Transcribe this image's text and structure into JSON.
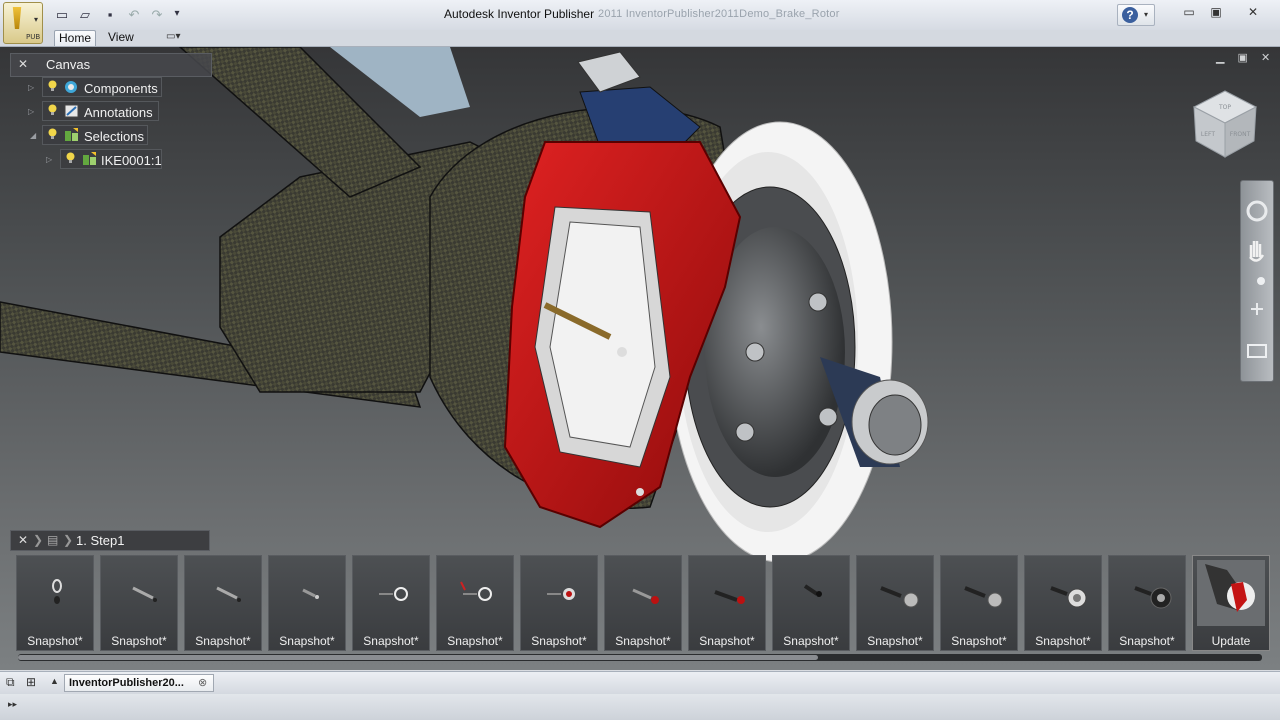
{
  "app": {
    "title": "Autodesk Inventor Publisher",
    "title_detail": "2011   InventorPublisher2011Demo_Brake_Rotor",
    "app_button_badge": "PUB"
  },
  "quick_access": [
    {
      "name": "new-icon",
      "glyph": "▭"
    },
    {
      "name": "open-icon",
      "glyph": "▱"
    },
    {
      "name": "save-icon",
      "glyph": "▪"
    },
    {
      "name": "undo-icon",
      "glyph": "↶"
    },
    {
      "name": "redo-icon",
      "glyph": "↷"
    },
    {
      "name": "qat-dropdown-icon",
      "glyph": "▾"
    }
  ],
  "ribbon": {
    "tabs": [
      {
        "label": "Home",
        "active": true
      },
      {
        "label": "View",
        "active": false
      }
    ]
  },
  "window_controls": {
    "minimize": "▭",
    "restore": "▣",
    "close": "✕"
  },
  "canvas_browser": {
    "title": "Canvas",
    "items": [
      {
        "label": "Components",
        "icon": "components-icon"
      },
      {
        "label": "Annotations",
        "icon": "annotations-icon"
      },
      {
        "label": "Selections",
        "icon": "selections-icon"
      },
      {
        "label": "IKE0001:1",
        "icon": "part-icon"
      }
    ]
  },
  "viewcube": {
    "faces": [
      "TOP",
      "LEFT",
      "FRONT"
    ]
  },
  "storyboard": {
    "step_label": "1. Step1",
    "snapshots": [
      {
        "caption": "Snapshot*"
      },
      {
        "caption": "Snapshot*"
      },
      {
        "caption": "Snapshot*"
      },
      {
        "caption": "Snapshot*"
      },
      {
        "caption": "Snapshot*"
      },
      {
        "caption": "Snapshot*"
      },
      {
        "caption": "Snapshot*"
      },
      {
        "caption": "Snapshot*"
      },
      {
        "caption": "Snapshot*"
      },
      {
        "caption": "Snapshot*"
      },
      {
        "caption": "Snapshot*"
      },
      {
        "caption": "Snapshot*"
      },
      {
        "caption": "Snapshot*"
      },
      {
        "caption": "Snapshot*"
      },
      {
        "caption": "Update"
      }
    ]
  },
  "document_tabs": [
    {
      "label": "InventorPublisher20...",
      "close_glyph": "⊗"
    }
  ],
  "colors": {
    "caliper_red": "#c41414",
    "rotor_white": "#f4f4f4",
    "carbon": "#3b3a33",
    "viewport_top": "#353638",
    "viewport_bottom": "#7c8082"
  }
}
